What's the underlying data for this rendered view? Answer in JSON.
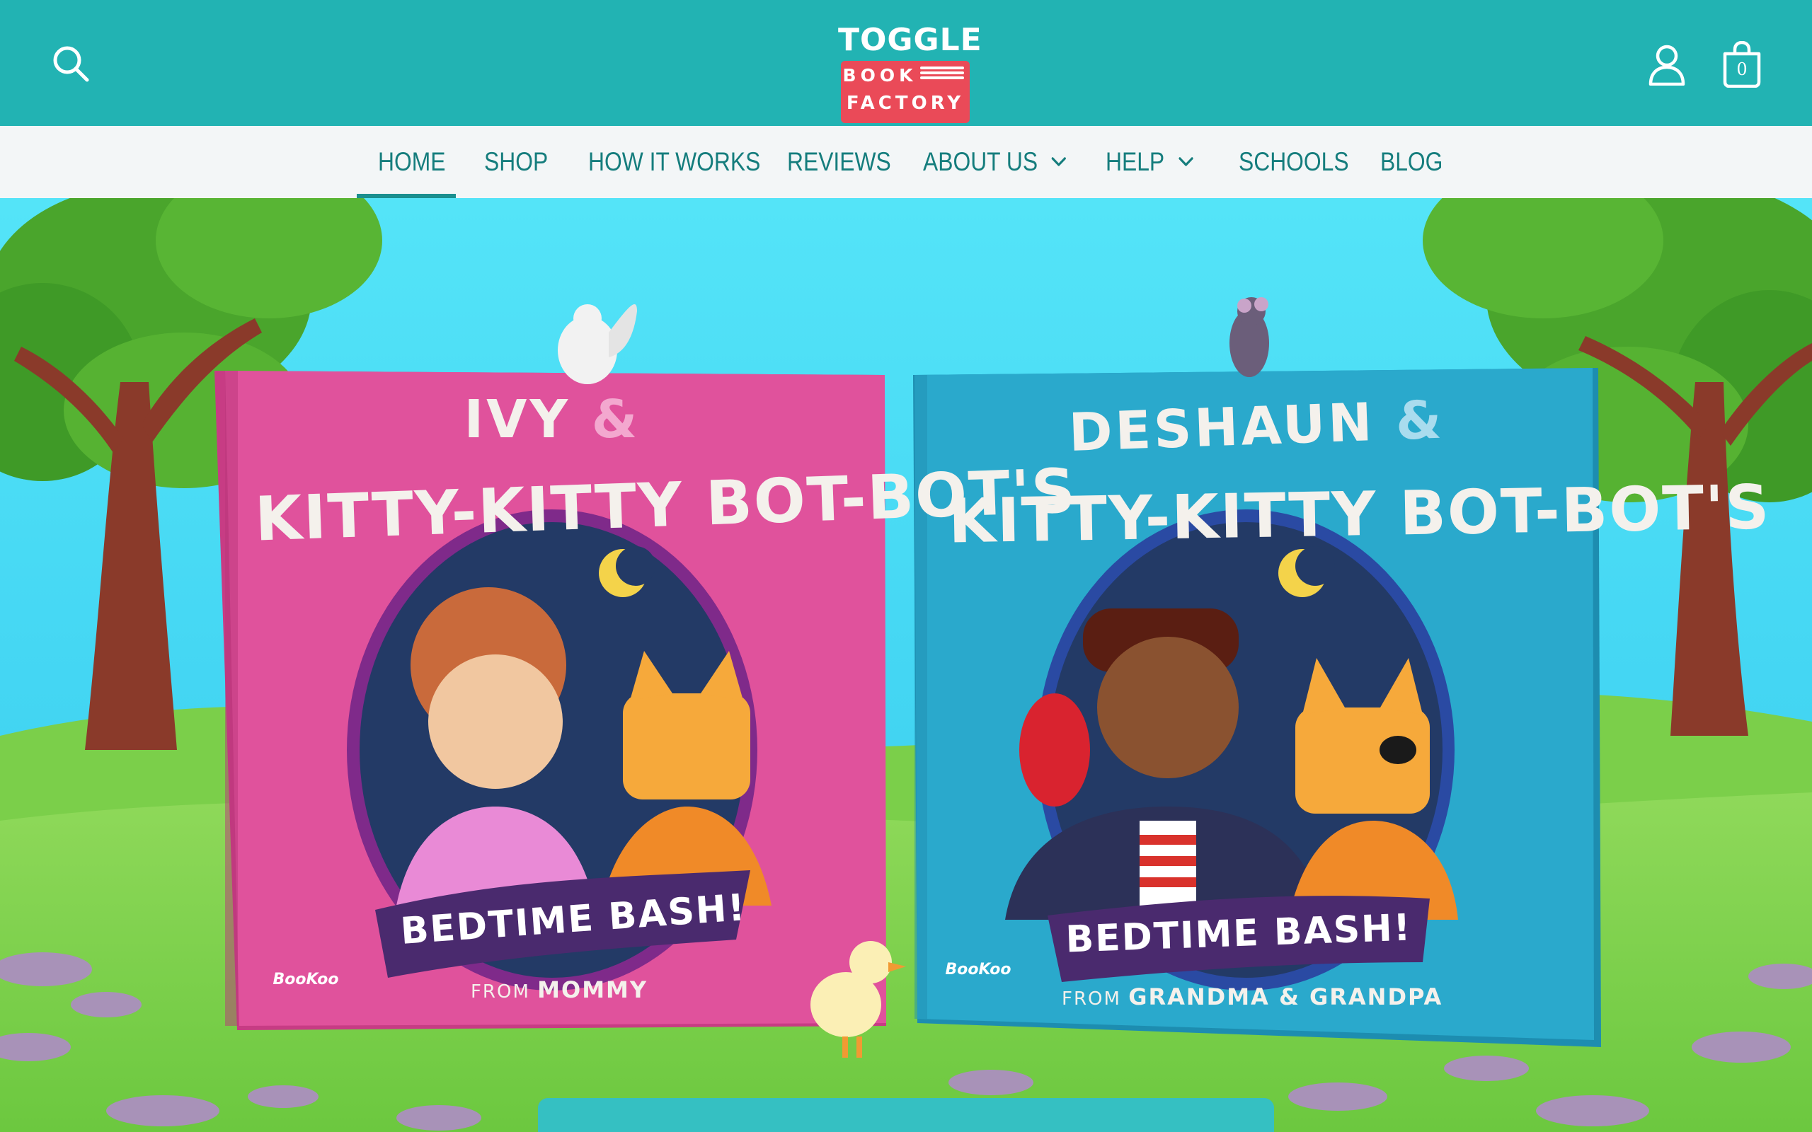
{
  "header": {
    "logo": {
      "line1": "TOGGLE",
      "line2": "BOOK",
      "line3": "FACTORY"
    },
    "cart_count": "0",
    "icons": {
      "search": "search-icon",
      "account": "user-icon",
      "cart": "shopping-bag-icon"
    },
    "colors": {
      "bar": "#22b3b3",
      "logo_plate": "#ea4a58"
    }
  },
  "nav": {
    "items": [
      {
        "label": "HOME",
        "active": true
      },
      {
        "label": "SHOP"
      },
      {
        "label": "HOW IT WORKS"
      },
      {
        "label": "REVIEWS"
      },
      {
        "label": "ABOUT US",
        "dropdown": true
      },
      {
        "label": "HELP",
        "dropdown": true
      },
      {
        "label": "SCHOOLS"
      },
      {
        "label": "BLOG"
      }
    ],
    "colors": {
      "text": "#157d7d",
      "background": "#f3f6f7"
    }
  },
  "hero": {
    "books": [
      {
        "name": "IVY",
        "ampersand": "&",
        "title": "KITTY-KITTY BOT-BOT'S",
        "ribbon": "BEDTIME BASH!",
        "from_prefix": "FROM",
        "from_name": "MOMMY",
        "brand": "BooKoo",
        "cover_color": "#e0529c"
      },
      {
        "name": "DESHAUN",
        "ampersand": "&",
        "title": "KITTY-KITTY BOT-BOT'S",
        "ribbon": "BEDTIME BASH!",
        "from_prefix": "FROM",
        "from_name": "GRANDMA & GRANDPA",
        "brand": "BooKoo",
        "cover_color": "#2aa9cc"
      }
    ]
  }
}
